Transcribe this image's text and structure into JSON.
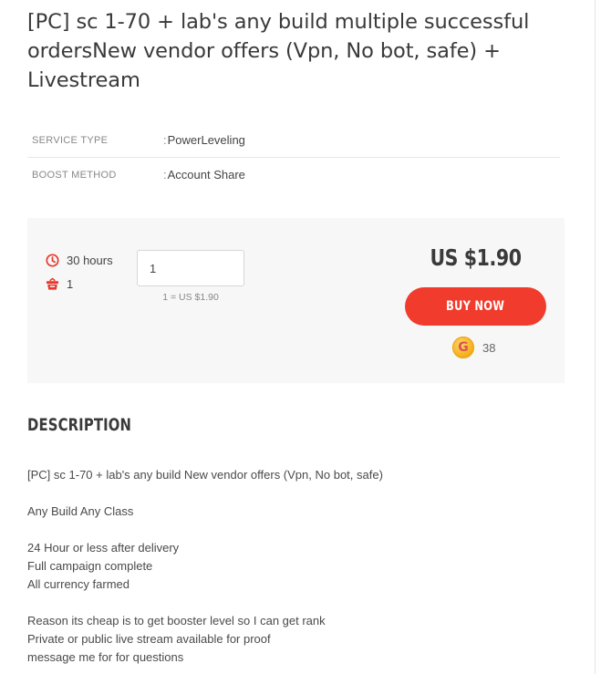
{
  "title": "[PC] sc 1-70 + lab's any build multiple successful ordersNew vendor offers (Vpn, No bot, safe) + Livestream",
  "specs": [
    {
      "key": "SERVICE TYPE",
      "value": "PowerLeveling"
    },
    {
      "key": "BOOST METHOD",
      "value": "Account Share"
    }
  ],
  "spec_separator": ":",
  "order": {
    "delivery_time": "30 hours",
    "stock": "1",
    "quantity_value": "1",
    "unit_price": "1 = US $1.90",
    "price": "US $1.90",
    "buy_label": "BUY NOW",
    "gold_symbol": "G",
    "gold_count": "38"
  },
  "description": {
    "heading": "DESCRIPTION",
    "lines": [
      "[PC] sc 1-70 + lab's any build New vendor offers (Vpn, No bot, safe)",
      "",
      "Any Build Any Class",
      "",
      "24 Hour or less after delivery",
      "Full campaign complete",
      "All currency farmed",
      "",
      "Reason its cheap is to get booster level so I can get rank",
      "Private or public live stream available for proof",
      "message me for for questions"
    ]
  },
  "colors": {
    "accent": "#f13b2c",
    "panel_bg": "#f7f7f7",
    "gold": "#f5b21c"
  },
  "icons": {
    "time": "clock-icon",
    "stock": "basket-icon",
    "currency": "gold-coin-icon"
  }
}
